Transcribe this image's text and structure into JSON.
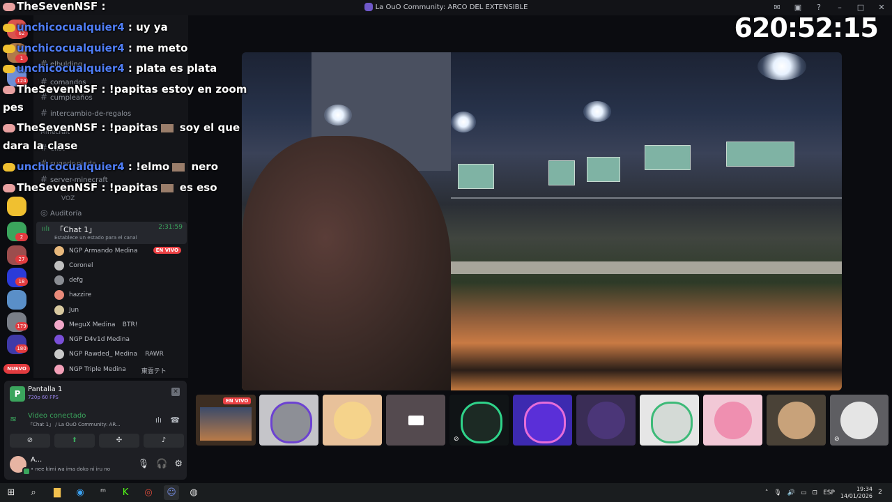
{
  "window": {
    "title": "La OuO Community: ARCO DEL EXTENSIBLE",
    "controls": [
      "inbox-icon",
      "screen-icon",
      "help-icon",
      "minimize-icon",
      "maximize-icon",
      "close-icon"
    ]
  },
  "timer": "620:52:15",
  "rail": {
    "badges": [
      "62",
      "1",
      "124",
      "2",
      "27",
      "18",
      "179",
      "180"
    ],
    "nuevo": "NUEVO"
  },
  "channels": {
    "items": [
      "elbulding",
      "comandos",
      "cumpleaños",
      "intercambio-de-regalos",
      "elist",
      "sugerir-pinda",
      "server-minecraft"
    ],
    "category_minecraft": "Minecraft",
    "voice_category": "VOZ",
    "auditoria": "Auditoría",
    "active": {
      "name": "「Chat 1」",
      "time": "2:31:59",
      "status": "Establece un estado para el canal"
    },
    "members": [
      {
        "name": "NGP Armando Medina",
        "live": "EN VIVO",
        "color": "#e8b87c"
      },
      {
        "name": "Coronel",
        "color": "#c0c0c0"
      },
      {
        "name": "defg",
        "color": "#8a8d93"
      },
      {
        "name": "hazzire",
        "color": "#e98a7a"
      },
      {
        "name": "Jun",
        "color": "#d8c9a0"
      },
      {
        "name": "MeguX Medina",
        "tag": "BTR!",
        "color": "#f1a7c8"
      },
      {
        "name": "NGP D4v1d Medina",
        "color": "#7a4fd8"
      },
      {
        "name": "NGP Rawded_ Medina",
        "tag": "RAWR",
        "color": "#c9c9c9"
      },
      {
        "name": "NGP Triple Medina",
        "tag": "東雲テト",
        "color": "#f3a0b8"
      }
    ]
  },
  "stream": {
    "title": "Pantalla 1",
    "quality": "720p 60 FPS",
    "voice_status": "Video conectado",
    "voice_channel": "「Chat 1」 / La OuO Community: AR...",
    "user": {
      "name": "A...",
      "status": "• nee kimi wa ima doko ni iru no"
    }
  },
  "thumbs": {
    "live_label": "EN VIVO"
  },
  "chat": [
    {
      "user": "TheSevenNSF",
      "text": " :",
      "user_color": "white"
    },
    {
      "user": "unchicocualquier4",
      "text": " : uy ya",
      "user_color": "blue"
    },
    {
      "user": "unchicocualquier4",
      "text": " : me meto",
      "user_color": "blue"
    },
    {
      "user": "unchicocualquier4",
      "text": " : plata es plata",
      "user_color": "blue"
    },
    {
      "user": "TheSevenNSF",
      "text": " : !papitas estoy en zoom",
      "user_color": "white"
    },
    {
      "user": "",
      "text": "pes",
      "user_color": "white"
    },
    {
      "user": "TheSevenNSF",
      "text": " : !papitas",
      "tail": " soy el que",
      "user_color": "white"
    },
    {
      "user": "",
      "text": "dara la clase",
      "user_color": "white"
    },
    {
      "user": "unchicocualquier4",
      "text": " : !elmo",
      "tail": " nero",
      "user_color": "blue"
    },
    {
      "user": "TheSevenNSF",
      "text": " : !papitas",
      "tail": "       es eso",
      "user_color": "white"
    }
  ],
  "taskbar": {
    "lang": "ESP",
    "time": "19:34",
    "date": "14/01/2026",
    "notif": "2"
  }
}
